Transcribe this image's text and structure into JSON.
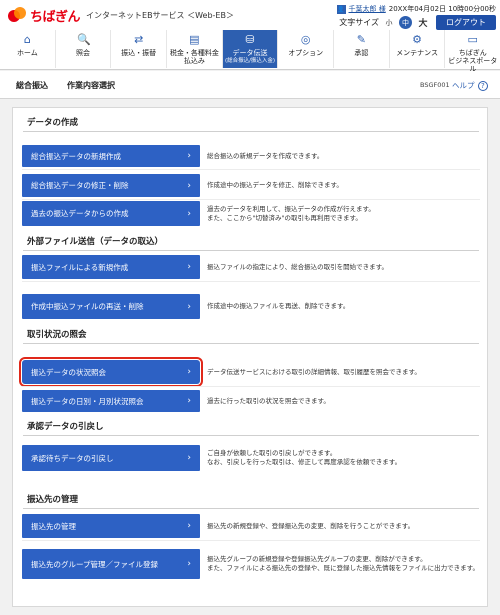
{
  "header": {
    "logo_name": "ちばぎん",
    "service_name": "インターネットEBサービス ＜Web-EB＞",
    "user_name": "千葉太郎 様",
    "login_time": "20XX年04月02日 10時00分00秒",
    "font_size_label": "文字サイズ",
    "font_small": "小",
    "font_mid": "中",
    "font_large": "大",
    "logout_label": "ログアウト"
  },
  "nav": [
    {
      "label": "ホーム",
      "icon": "home-icon"
    },
    {
      "label": "照会",
      "icon": "inquiry-icon"
    },
    {
      "label": "振込・振替",
      "icon": "transfer-icon"
    },
    {
      "label": "税金・各種料金\n払込み",
      "icon": "tax-icon"
    },
    {
      "label": "データ伝送",
      "sub": "(総合振込/振込入金)",
      "icon": "data-transmission-icon",
      "active": true
    },
    {
      "label": "オプション",
      "icon": "option-icon"
    },
    {
      "label": "承認",
      "icon": "approval-icon"
    },
    {
      "label": "メンテナンス",
      "icon": "maintenance-icon"
    },
    {
      "label": "ちばぎん\nビジネスポータル",
      "icon": "portal-icon"
    }
  ],
  "title": {
    "main": "総合振込",
    "sub": "作業内容選択",
    "screen_code": "BSGF001",
    "help_label": "ヘルプ"
  },
  "sections": [
    {
      "heading": "データの作成",
      "items": [
        {
          "label": "総合振込データの新規作成",
          "desc": "総合振込の新規データを作成できます。"
        },
        {
          "label": "総合振込データの修正・削除",
          "desc": "作成途中の振込データを修正、削除できます。"
        },
        {
          "label": "過去の振込データからの作成",
          "desc": "過去のデータを利用して、振込データの作成が行えます。\nまた、ここから\"切替済み\"の取引も再利用できます。"
        }
      ]
    },
    {
      "heading": "外部ファイル送信（データの取込）",
      "items": [
        {
          "label": "振込ファイルによる新規作成",
          "desc": "振込ファイルの指定により、総合振込の取引を開始できます。"
        },
        {
          "label": "作成中振込ファイルの再送・削除",
          "desc": "作成途中の振込ファイルを再送、削除できます。"
        }
      ]
    },
    {
      "heading": "取引状況の照会",
      "items": [
        {
          "label": "振込データの状況照会",
          "desc": "データ伝送サービスにおける取引の詳細情報、取引履歴を照会できます。",
          "highlighted": true
        },
        {
          "label": "振込データの日別・月別状況照会",
          "desc": "過去に行った取引の状況を照会できます。"
        }
      ]
    },
    {
      "heading": "承認データの引戻し",
      "items": [
        {
          "label": "承認待ちデータの引戻し",
          "desc": "ご自身が依頼した取引の引戻しができます。\nなお、引戻しを行った取引は、修正して再度承認を依頼できます。"
        }
      ]
    },
    {
      "heading": "振込先の管理",
      "items": [
        {
          "label": "振込先の管理",
          "desc": "振込先の新規登録や、登録振込先の変更、削除を行うことができます。"
        },
        {
          "label": "振込先のグループ管理／ファイル登録",
          "desc": "振込先グループの新規登録や登録振込先グループの変更、削除ができます。\nまた、ファイルによる振込先の登録や、既に登録した振込先情報をファイルに出力できます。"
        }
      ]
    }
  ],
  "colors": {
    "brand": "#e60012",
    "primary": "#2d61c4",
    "highlight": "#e0281a"
  }
}
